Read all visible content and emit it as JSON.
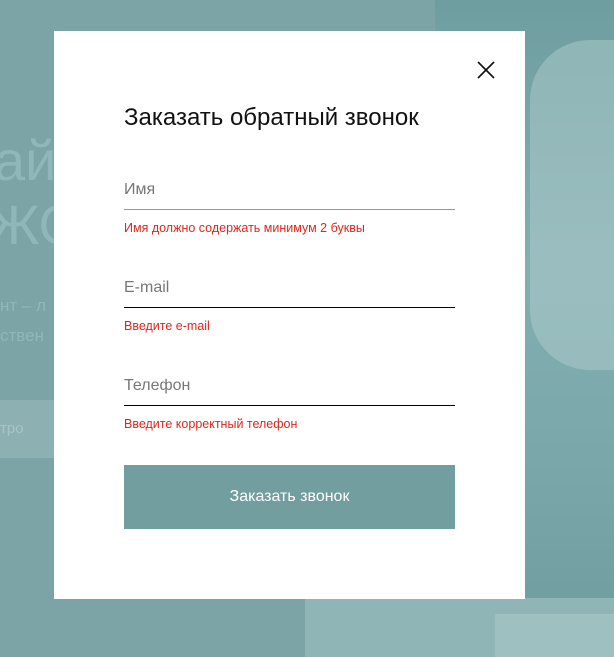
{
  "background": {
    "heading_line_1": "ай",
    "heading_line_2": "ЖО",
    "sub_line_1": "нт – л",
    "sub_line_2": "ствен",
    "button_label": "тро"
  },
  "modal": {
    "title": "Заказать обратный звонок",
    "close_icon": "close-icon",
    "fields": {
      "name": {
        "placeholder": "Имя",
        "value": "",
        "error": "Имя должно содержать минимум 2 буквы"
      },
      "email": {
        "placeholder": "E-mail",
        "value": "",
        "error": "Введите e-mail"
      },
      "phone": {
        "placeholder": "Телефон",
        "value": "",
        "error": "Введите корректный телефон"
      }
    },
    "submit_label": "Заказать звонок"
  },
  "colors": {
    "accent": "#729e9f",
    "overlay": "#7ca4a6",
    "error": "#e0251b"
  }
}
